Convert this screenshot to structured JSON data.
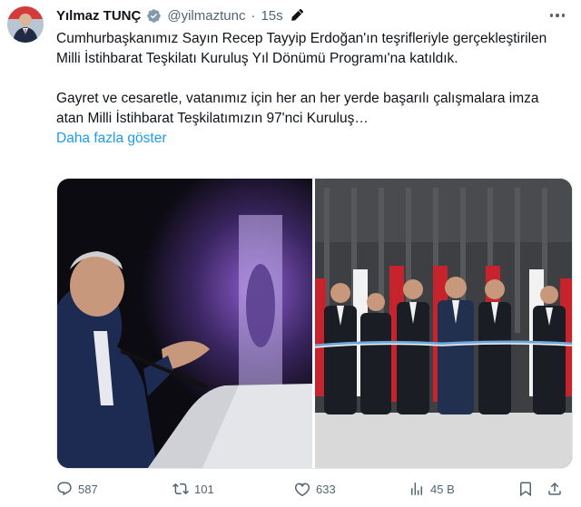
{
  "tweet": {
    "author_name": "Yılmaz TUNÇ",
    "handle": "@yilmaztunc",
    "separator": "·",
    "time": "15s",
    "paragraph1": "Cumhurbaşkanımız Sayın Recep Tayyip Erdoğan'ın teşrifleriyle gerçekleştirilen Milli İstihbarat Teşkilatı Kuruluş Yıl Dönümü Programı'na katıldık.",
    "paragraph2": "Gayret ve cesaretle, vatanımız için her an her yerde başarılı çalışmalara imza atan Milli İstihbarat Teşkilatımızın 97'nci Kuruluş…",
    "show_more": "Daha fazla göster"
  },
  "actions": {
    "replies": "587",
    "retweets": "101",
    "likes": "633",
    "views": "45 B"
  },
  "colors": {
    "link": "#1d9bf0",
    "muted": "#536471",
    "verified": "#829aab"
  },
  "icons": [
    "avatar",
    "verified-badge-icon",
    "edit-icon",
    "more-icon",
    "reply-icon",
    "retweet-icon",
    "like-icon",
    "views-icon",
    "bookmark-icon",
    "share-icon"
  ]
}
